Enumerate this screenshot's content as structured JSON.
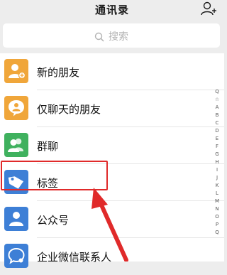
{
  "header": {
    "title": "通讯录",
    "add_icon": "add-friend-icon"
  },
  "search": {
    "placeholder": "搜索",
    "icon": "search-icon"
  },
  "items": [
    {
      "label": "新的朋友",
      "icon": "new-friend-icon",
      "color": "#f0a63a"
    },
    {
      "label": "仅聊天的朋友",
      "icon": "chat-only-friend-icon",
      "color": "#f0a63a"
    },
    {
      "label": "群聊",
      "icon": "group-chat-icon",
      "color": "#3fb15e"
    },
    {
      "label": "标签",
      "icon": "tag-icon",
      "color": "#3d7fd6"
    },
    {
      "label": "公众号",
      "icon": "official-account-icon",
      "color": "#3d7fd6"
    },
    {
      "label": "企业微信联系人",
      "icon": "enterprise-contact-icon",
      "color": "#3d7fd6"
    }
  ],
  "index_letters": [
    "Q",
    "☆",
    "A",
    "B",
    "C",
    "D",
    "E",
    "F",
    "G",
    "H",
    "I",
    "J",
    "K",
    "L",
    "M",
    "N",
    "O",
    "P",
    "Q"
  ],
  "annotation": {
    "highlight_color": "#e02a2a"
  }
}
